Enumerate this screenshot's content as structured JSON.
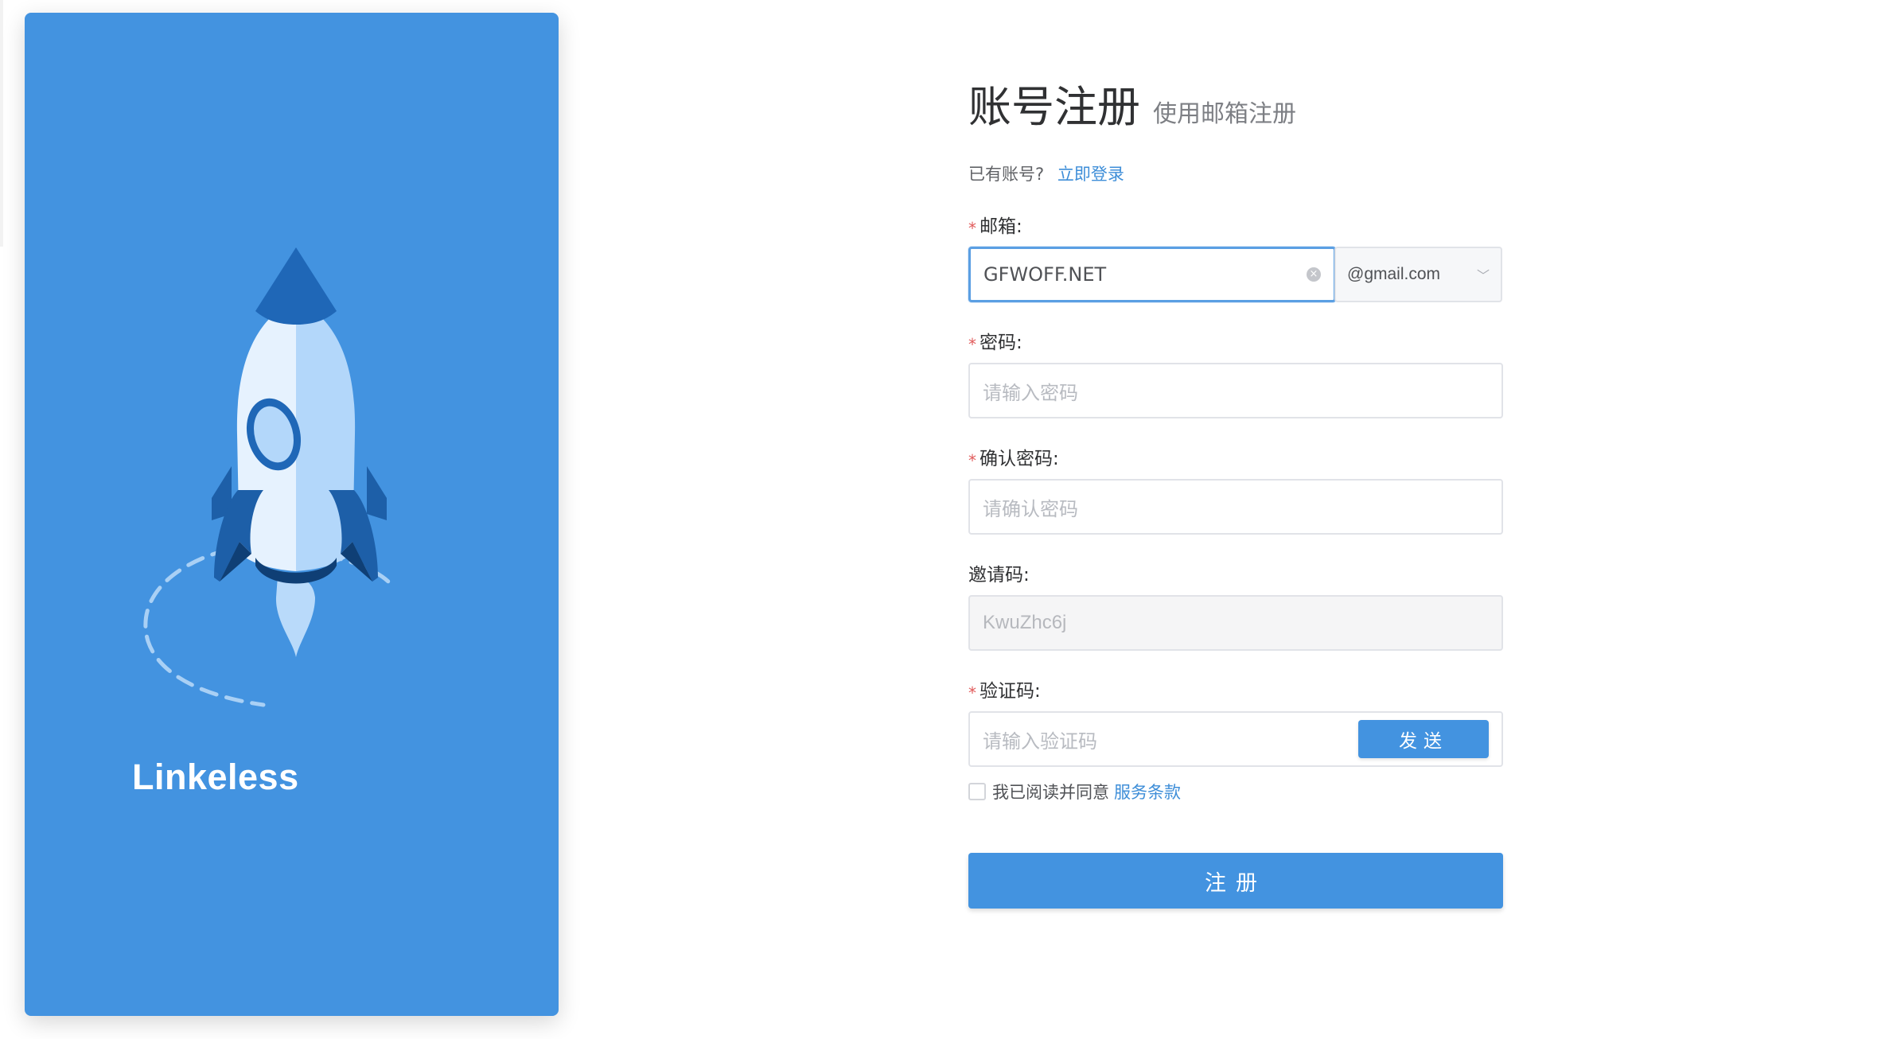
{
  "hero": {
    "brand": "Linkeless",
    "illustration": "rocket-illustration"
  },
  "form": {
    "title": "账号注册",
    "subtitle": "使用邮箱注册",
    "login_prompt": "已有账号?",
    "login_link": "立即登录",
    "required_mark": "*",
    "email": {
      "label": "邮箱:",
      "value": "GFWOFF.NET",
      "clear_icon": "×",
      "domain": "@gmail.com",
      "chevron_icon": "﹀"
    },
    "password": {
      "label": "密码:",
      "placeholder": "请输入密码"
    },
    "confirm_password": {
      "label": "确认密码:",
      "placeholder": "请确认密码"
    },
    "invite_code": {
      "label": "邀请码:",
      "value": "KwuZhc6j"
    },
    "verify_code": {
      "label": "验证码:",
      "placeholder": "请输入验证码",
      "send_label": "发送"
    },
    "agreement": {
      "text": "我已阅读并同意",
      "link": "服务条款",
      "checked": false
    },
    "submit_label": "注册"
  },
  "colors": {
    "accent": "#4393e0",
    "link": "#3e8ed8",
    "required": "#e15b5b"
  }
}
